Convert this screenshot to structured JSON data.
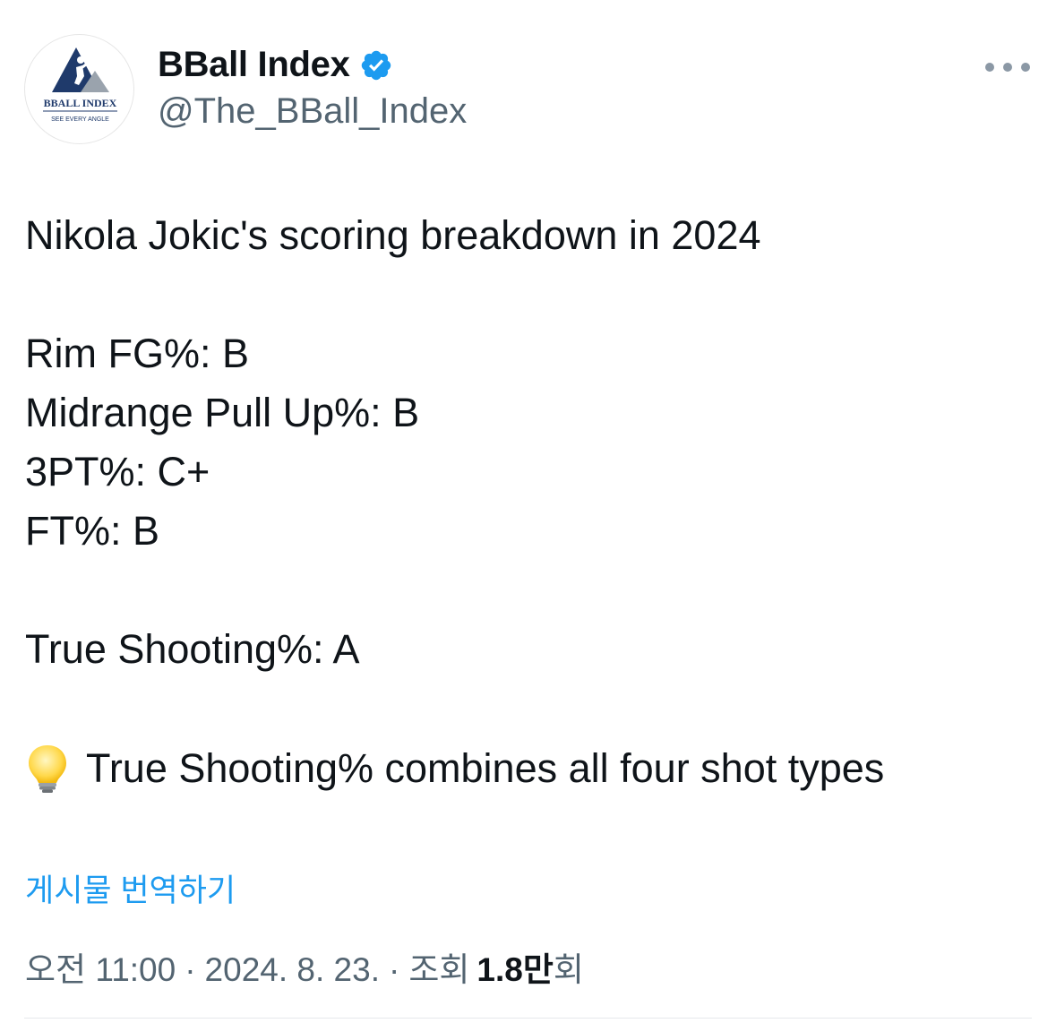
{
  "author": {
    "display_name": "BBall Index",
    "handle": "@The_BBall_Index",
    "verified": true,
    "avatar": {
      "icon": "bball-index-logo",
      "logo_text": "BBALL INDEX",
      "logo_tagline": "SEE EVERY ANGLE"
    }
  },
  "menu": {
    "icon": "more-horizontal-icon"
  },
  "tweet": {
    "title": "Nikola Jokic's scoring breakdown in 2024",
    "lines": [
      "Rim FG%: B",
      "Midrange Pull Up%: B",
      "3PT%: C+",
      "FT%: B"
    ],
    "summary": "True Shooting%: A",
    "note_icon": "lightbulb-icon",
    "note": "True Shooting% combines all four shot types"
  },
  "translate_label": "게시물 번역하기",
  "meta": {
    "time": "오전 11:00",
    "separator": "·",
    "date": "2024. 8. 23.",
    "views_label": "조회",
    "views_count": "1.8만",
    "views_suffix": "회"
  },
  "colors": {
    "text": "#0f1419",
    "secondary": "#536471",
    "link": "#1d9bf0",
    "verified": "#1d9bf0",
    "logo_navy": "#1f3a6b",
    "logo_gray": "#9aa3ad"
  }
}
